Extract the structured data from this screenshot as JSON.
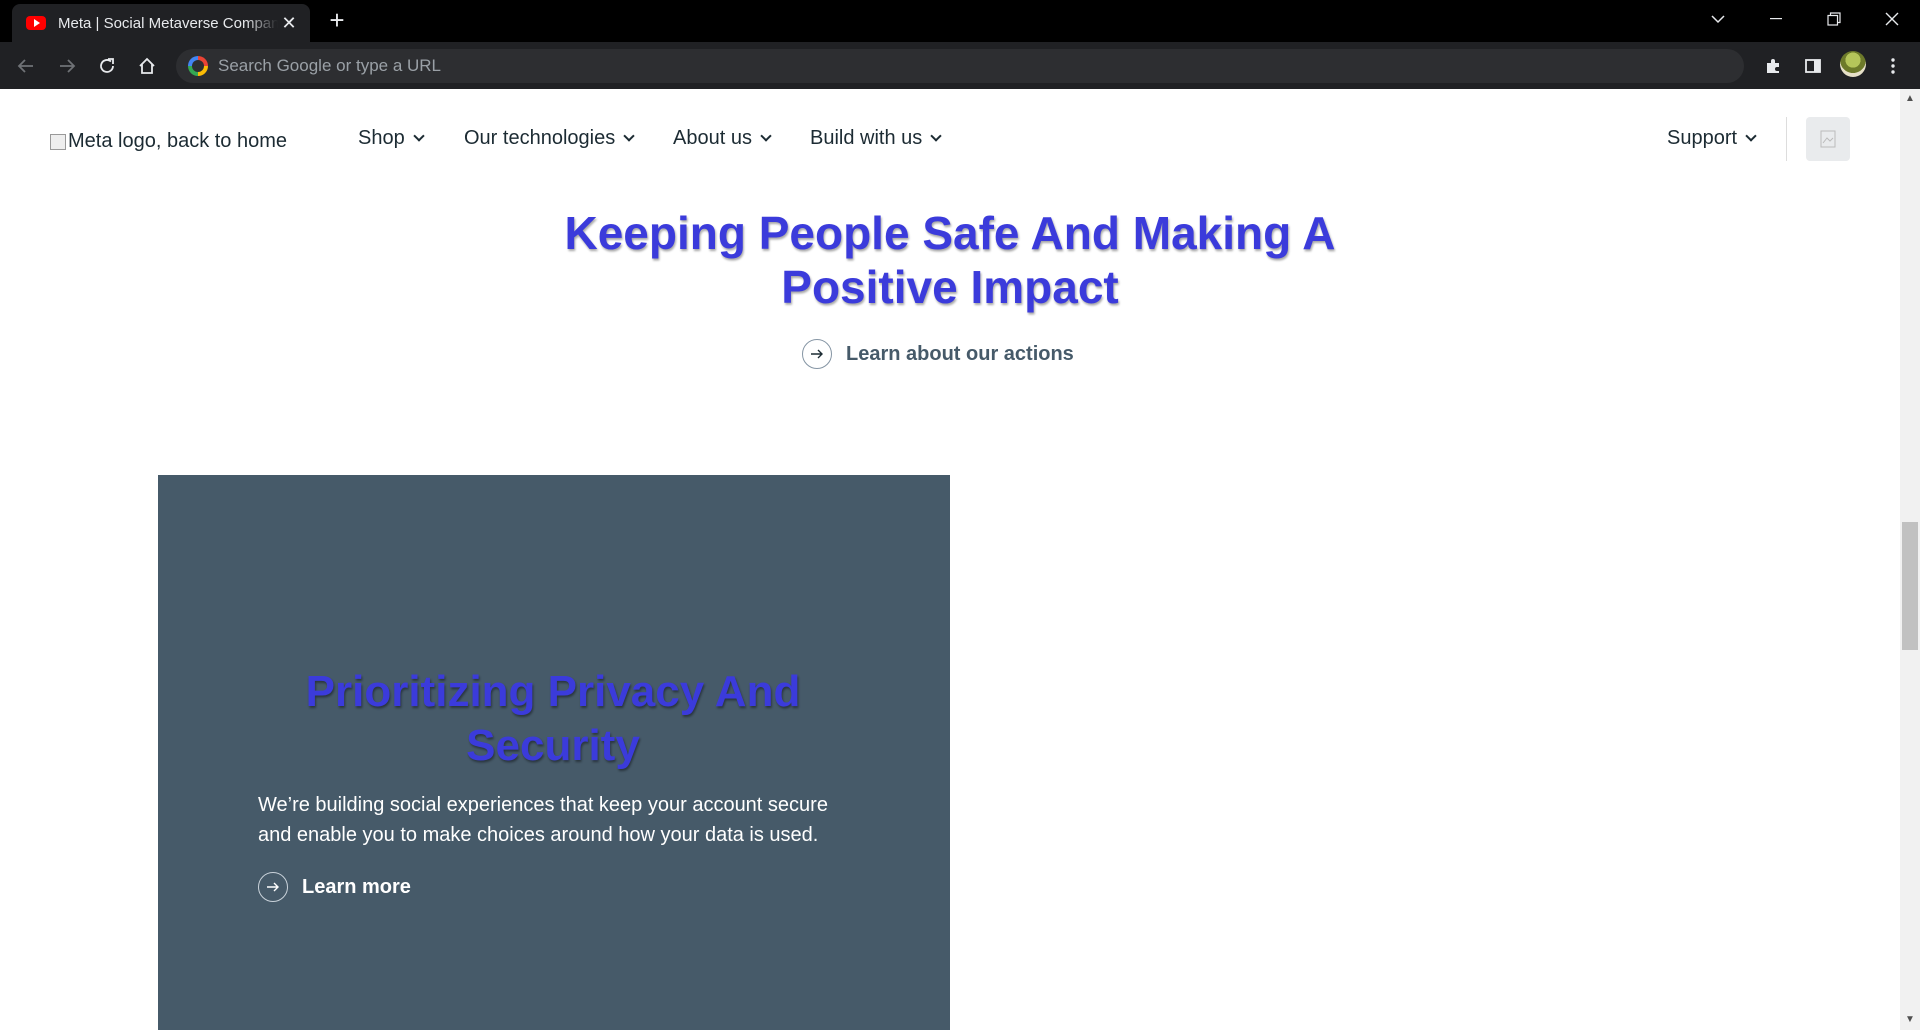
{
  "browser": {
    "tab_title": "Meta | Social Metaverse Company",
    "tab_close": "✕",
    "new_tab": "+",
    "omnibox_placeholder": "Search Google or type a URL",
    "window_controls": {
      "dropdown": "⌄",
      "minimize": "—",
      "restore": "❐",
      "close": "✕"
    }
  },
  "nav": {
    "logo_alt": "Meta logo, back to home",
    "items": [
      "Shop",
      "Our technologies",
      "About us",
      "Build with us"
    ],
    "support": "Support"
  },
  "hero": {
    "title": "Keeping People Safe And Making A Positive Impact",
    "link": "Learn about our actions"
  },
  "card": {
    "title": "Prioritizing Privacy And Security",
    "body": "We’re building social experiences that keep your account secure and enable you to make choices around how your data is used.",
    "link": "Learn more",
    "background": "#465a69"
  },
  "colors": {
    "heading_accent": "#3b3bdb",
    "text_dark": "#1c2b33"
  }
}
